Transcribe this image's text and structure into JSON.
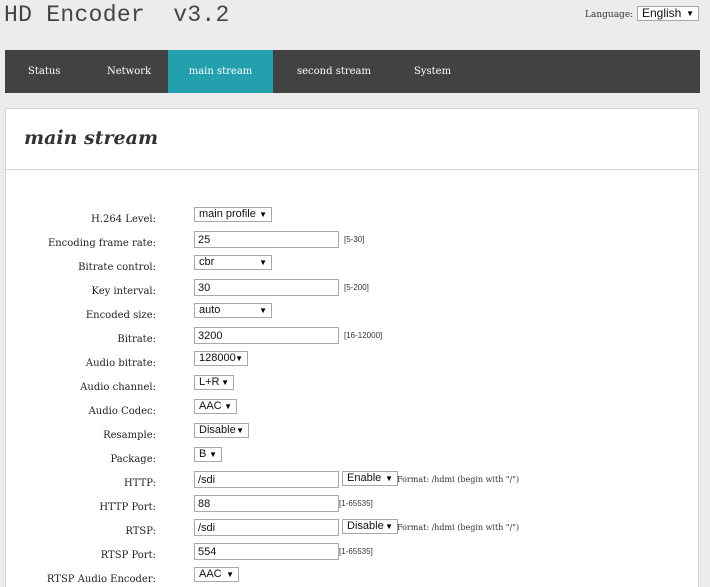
{
  "header": {
    "title": "HD Encoder  v3.2",
    "language_label": "Language:",
    "language_value": "English"
  },
  "nav": {
    "items": [
      {
        "label": "Status"
      },
      {
        "label": "Network"
      },
      {
        "label": "main stream"
      },
      {
        "label": "second stream"
      },
      {
        "label": "System"
      }
    ],
    "active_index": 2
  },
  "panel": {
    "title": "main stream"
  },
  "form": {
    "h264_level": {
      "label": "H.264 Level:",
      "value": "main profile"
    },
    "frame_rate": {
      "label": "Encoding frame rate:",
      "value": "25",
      "hint": "[5-30]"
    },
    "bitrate_control": {
      "label": "Bitrate control:",
      "value": "cbr"
    },
    "key_interval": {
      "label": "Key interval:",
      "value": "30",
      "hint": "[5-200]"
    },
    "encoded_size": {
      "label": "Encoded size:",
      "value": "auto"
    },
    "bitrate": {
      "label": "Bitrate:",
      "value": "3200",
      "hint": "[16-12000]"
    },
    "audio_bitrate": {
      "label": "Audio bitrate:",
      "value": "128000"
    },
    "audio_channel": {
      "label": "Audio channel:",
      "value": "L+R"
    },
    "audio_codec": {
      "label": "Audio Codec:",
      "value": "AAC"
    },
    "resample": {
      "label": "Resample:",
      "value": "Disable"
    },
    "package": {
      "label": "Package:",
      "value": "B"
    },
    "http": {
      "label": "HTTP:",
      "value": "/sdi",
      "toggle": "Enable",
      "hint": "Format: /hdmi (begin with \"/\")"
    },
    "http_port": {
      "label": "HTTP Port:",
      "value": "88",
      "hint": "[1-65535]"
    },
    "rtsp": {
      "label": "RTSP:",
      "value": "/sdi",
      "toggle": "Disable",
      "hint": "Format: /hdmi (begin with \"/\")"
    },
    "rtsp_port": {
      "label": "RTSP Port:",
      "value": "554",
      "hint": "[1-65535]"
    },
    "rtsp_audio_encoder": {
      "label": "RTSP Audio Encoder:",
      "value": "AAC"
    }
  }
}
